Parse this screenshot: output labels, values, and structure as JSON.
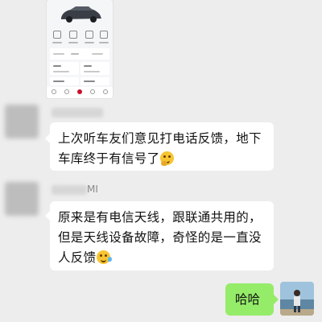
{
  "shared_image": {
    "description_label": "",
    "screen_rows": [
      "",
      "",
      ""
    ]
  },
  "messages": [
    {
      "sender": "",
      "text": "上次听车友们意见打电话反馈，地下车库终于有信号了",
      "emoji": "thinking-face"
    },
    {
      "sender_suffix": "MI",
      "text": "原来是有电信天线，跟联通共用的，但是天线设备故障，奇怪的是一直没人反馈",
      "emoji": "rolling-laughing-face"
    },
    {
      "text": "哈哈",
      "own": true
    }
  ],
  "colors": {
    "background": "#ededed",
    "incoming_bubble": "#ffffff",
    "outgoing_bubble": "#95ec69"
  }
}
